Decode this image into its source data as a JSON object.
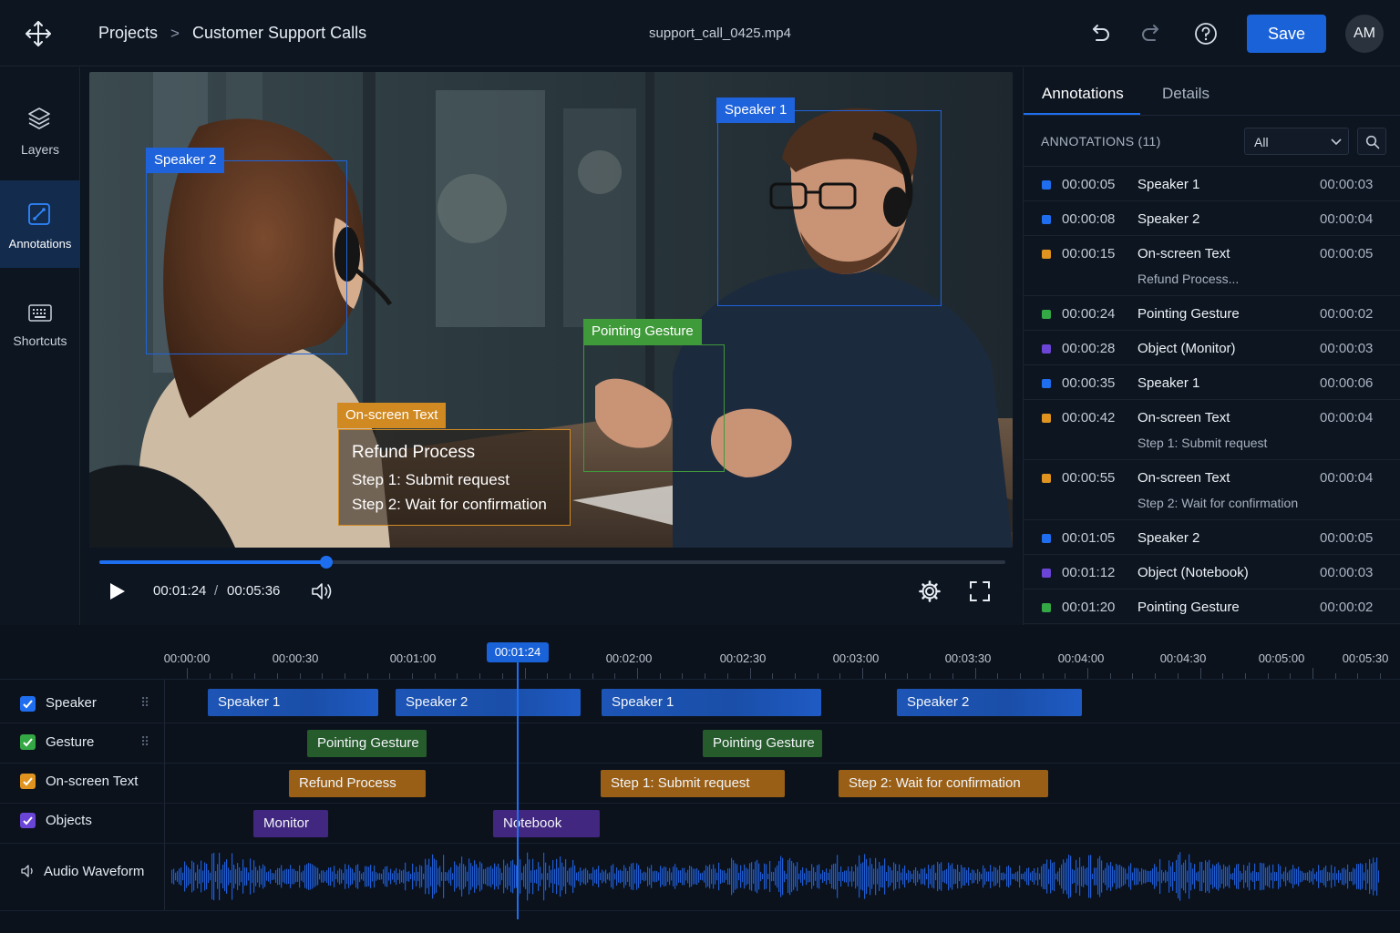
{
  "header": {
    "breadcrumb": [
      "Projects",
      "Customer Support Calls"
    ],
    "breadcrumb_separator": ">",
    "file_name": "support_call_0425.mp4",
    "save_label": "Save",
    "avatar_initials": "AM",
    "icons": [
      "move-icon",
      "undo-icon",
      "redo-icon",
      "help-icon"
    ]
  },
  "sidebar": {
    "items": [
      {
        "label": "Layers",
        "icon": "layers-icon",
        "active": false
      },
      {
        "label": "Annotations",
        "icon": "annotation-icon",
        "active": true
      },
      {
        "label": "Shortcuts",
        "icon": "keyboard-icon",
        "active": false
      }
    ]
  },
  "video": {
    "boxes": [
      {
        "label": "Speaker 2",
        "color": "#1f63dc"
      },
      {
        "label": "Speaker 1",
        "color": "#1f63dc"
      },
      {
        "label": "Pointing Gesture",
        "color": "#3f9a3a"
      },
      {
        "label": "On-screen Text",
        "color": "#d18a22"
      }
    ],
    "onscreen_text": [
      "Refund Process",
      "Step 1: Submit request",
      "Step 2: Wait for confirmation"
    ],
    "current_time": "00:01:24",
    "time_separator": "/",
    "total_time": "00:05:36",
    "progress_fraction": 0.25
  },
  "panel": {
    "tabs": [
      "Annotations",
      "Details"
    ],
    "active_tab": "Annotations",
    "annotations_title": "ANNOTATIONS (11)",
    "filter_value": "All",
    "annotations": [
      {
        "time": "00:00:05",
        "label": "Speaker 1",
        "sub": "",
        "duration": "00:00:03",
        "color": "#1f6ef0"
      },
      {
        "time": "00:00:08",
        "label": "Speaker 2",
        "sub": "",
        "duration": "00:00:04",
        "color": "#1f6ef0"
      },
      {
        "time": "00:00:15",
        "label": "On-screen Text",
        "sub": "Refund Process...",
        "duration": "00:00:05",
        "color": "#e0941f"
      },
      {
        "time": "00:00:24",
        "label": "Pointing Gesture",
        "sub": "",
        "duration": "00:00:02",
        "color": "#34a845"
      },
      {
        "time": "00:00:28",
        "label": "Object (Monitor)",
        "sub": "",
        "duration": "00:00:03",
        "color": "#6a45d6"
      },
      {
        "time": "00:00:35",
        "label": "Speaker 1",
        "sub": "",
        "duration": "00:00:06",
        "color": "#1f6ef0"
      },
      {
        "time": "00:00:42",
        "label": "On-screen Text",
        "sub": "Step 1: Submit request",
        "duration": "00:00:04",
        "color": "#e0941f"
      },
      {
        "time": "00:00:55",
        "label": "On-screen Text",
        "sub": "Step 2: Wait for confirmation",
        "duration": "00:00:04",
        "color": "#e0941f"
      },
      {
        "time": "00:01:05",
        "label": "Speaker 2",
        "sub": "",
        "duration": "00:00:05",
        "color": "#1f6ef0"
      },
      {
        "time": "00:01:12",
        "label": "Object (Notebook)",
        "sub": "",
        "duration": "00:00:03",
        "color": "#6a45d6"
      },
      {
        "time": "00:01:20",
        "label": "Pointing Gesture",
        "sub": "",
        "duration": "00:00:02",
        "color": "#34a845"
      }
    ]
  },
  "timeline": {
    "ruler": [
      "00:00:00",
      "00:00:30",
      "00:01:00",
      "00:01:30",
      "00:02:00",
      "00:02:30",
      "00:03:00",
      "00:03:30",
      "00:04:00",
      "00:04:30",
      "00:05:00",
      "00:05:30"
    ],
    "playhead": "00:01:24",
    "tracks": [
      {
        "name": "Speaker",
        "checked": true,
        "color": "#1f6ef0",
        "drag": "⠿"
      },
      {
        "name": "Gesture",
        "checked": true,
        "color": "#34a845",
        "drag": "⠿"
      },
      {
        "name": "On-screen Text",
        "checked": true,
        "color": "#e0941f",
        "drag": ""
      },
      {
        "name": "Objects",
        "checked": true,
        "color": "#6a45d6",
        "drag": ""
      }
    ],
    "audio_label": "Audio Waveform",
    "clips": {
      "speaker": [
        "Speaker 1",
        "Speaker 2",
        "Speaker 1",
        "Speaker 2"
      ],
      "gesture": [
        "Pointing Gesture",
        "Pointing Gesture"
      ],
      "text": [
        "Refund Process",
        "Step 1: Submit request",
        "Step 2: Wait for confirmation"
      ],
      "objects": [
        "Monitor",
        "Notebook"
      ]
    }
  }
}
